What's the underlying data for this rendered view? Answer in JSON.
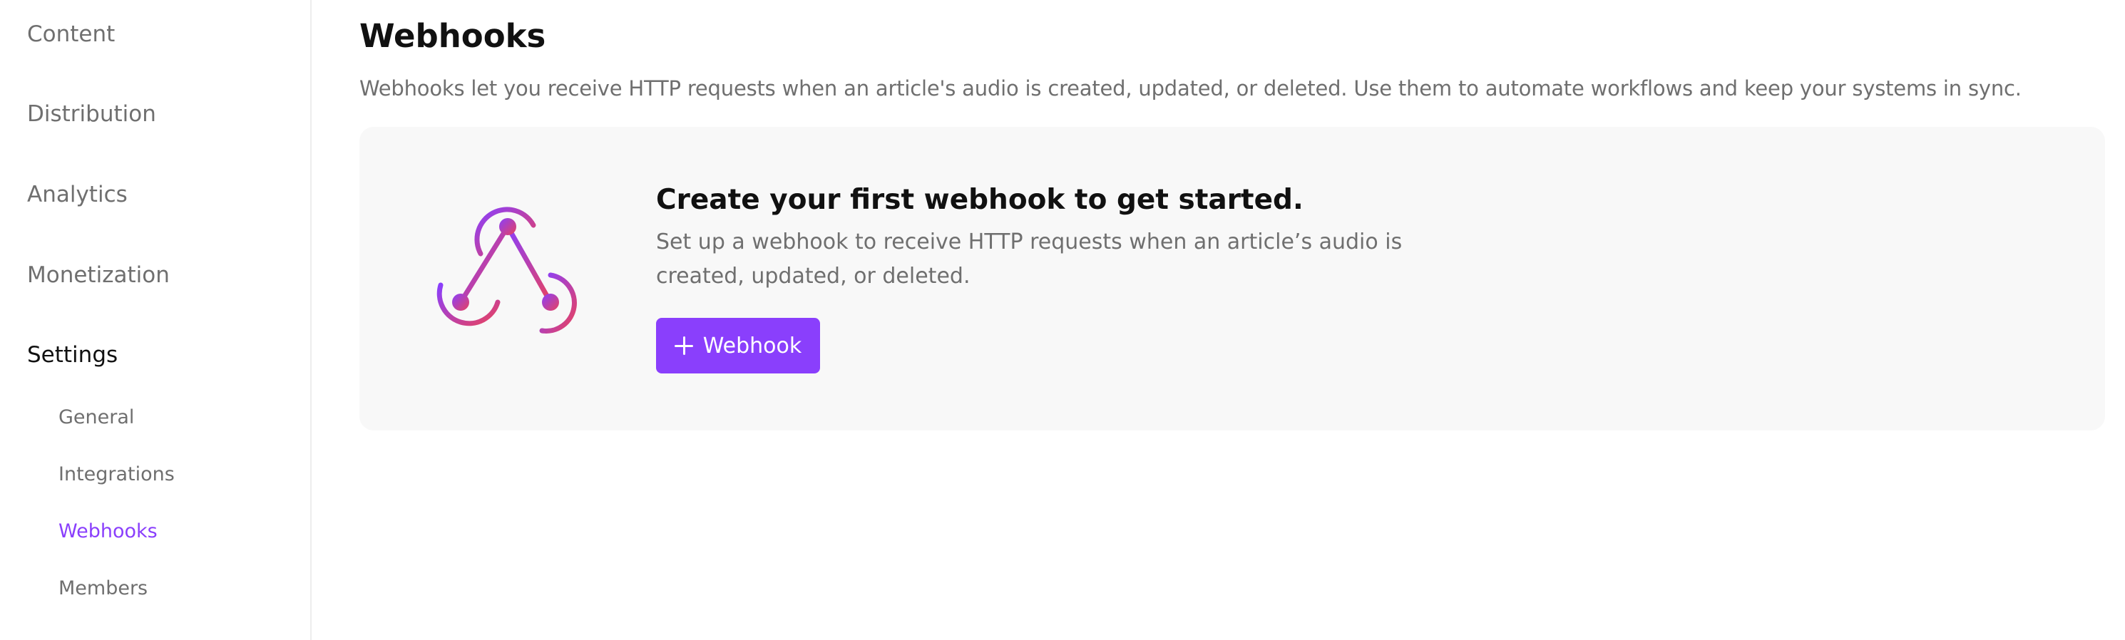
{
  "sidebar": {
    "items": [
      {
        "label": "Content"
      },
      {
        "label": "Distribution"
      },
      {
        "label": "Analytics"
      },
      {
        "label": "Monetization"
      },
      {
        "label": "Settings"
      }
    ],
    "settings_subitems": [
      {
        "label": "General"
      },
      {
        "label": "Integrations"
      },
      {
        "label": "Webhooks"
      },
      {
        "label": "Members"
      }
    ],
    "active_item": "Settings",
    "active_subitem": "Webhooks"
  },
  "main": {
    "title": "Webhooks",
    "description": "Webhooks let you receive HTTP requests when an article's audio is created, updated, or deleted. Use them to automate workflows and keep your systems in sync.",
    "empty_state": {
      "icon": "webhook-icon",
      "title": "Create your first webhook to get started.",
      "description": "Set up a webhook to receive HTTP requests when an article’s audio is created, updated, or deleted.",
      "button_label": "Webhook",
      "button_icon": "plus-icon"
    }
  },
  "colors": {
    "accent": "#8a3ffc",
    "gradient_start": "#8a3ffc",
    "gradient_end": "#e8425f",
    "card_background": "#f8f8f8",
    "muted_text": "#6f6f6f"
  }
}
